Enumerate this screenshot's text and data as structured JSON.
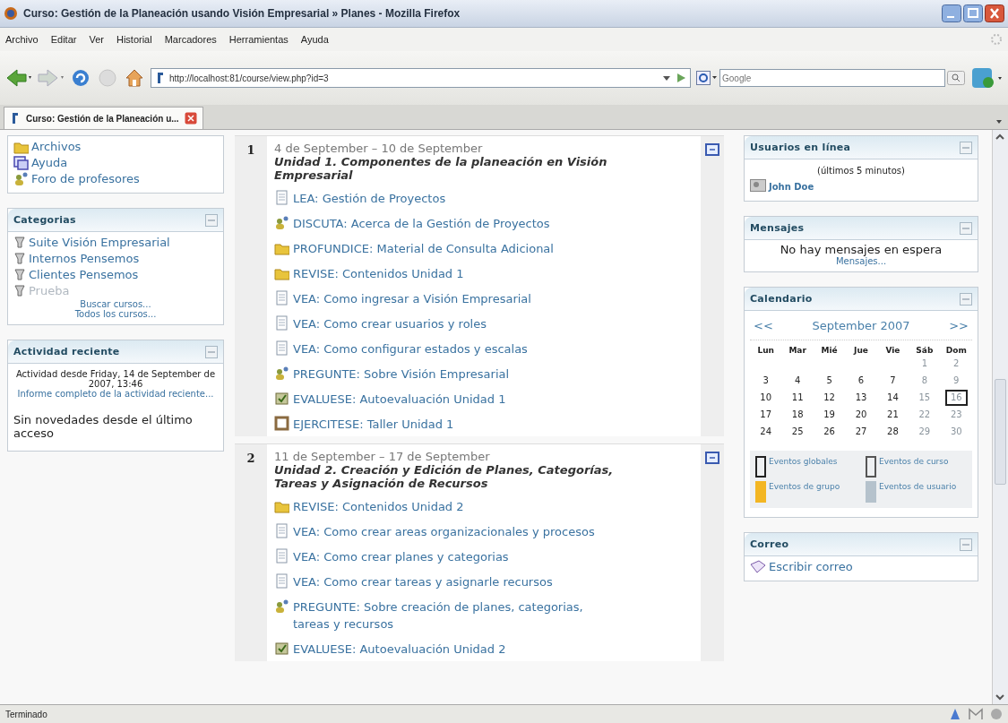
{
  "window": {
    "title": "Curso: Gestión de la Planeación usando Visión Empresarial » Planes - Mozilla Firefox"
  },
  "menu": [
    "Archivo",
    "Editar",
    "Ver",
    "Historial",
    "Marcadores",
    "Herramientas",
    "Ayuda"
  ],
  "toolbar": {
    "url": "http://localhost:81/course/view.php?id=3",
    "search": {
      "placeholder": "Google"
    }
  },
  "tabs": [
    {
      "label": "Curso: Gestión de la Planeación u...",
      "selected": true
    }
  ],
  "left_blocks": [
    {
      "kind": "links",
      "items": [
        {
          "kind": "folder",
          "label": "Archivos"
        },
        {
          "kind": "window",
          "label": "Ayuda"
        },
        {
          "kind": "forum",
          "label": "Foro de profesores"
        }
      ]
    },
    {
      "kind": "categories",
      "title": "Categorias",
      "items": [
        {
          "label": "Suite Visión Empresarial",
          "dimmed": false
        },
        {
          "label": "Internos Pensemos",
          "dimmed": false
        },
        {
          "label": "Clientes Pensemos",
          "dimmed": false
        },
        {
          "label": "Prueba",
          "dimmed": true
        }
      ],
      "links": [
        "Buscar cursos...",
        "Todos los cursos..."
      ]
    },
    {
      "kind": "activity",
      "title": "Actividad reciente",
      "since": "Actividad desde Friday, 14 de September de 2007, 13:46",
      "link": "Informe completo de la actividad reciente...",
      "note": "Sin novedades desde el último acceso"
    }
  ],
  "sections": [
    {
      "number": "1",
      "dates": "4 de September – 10 de September",
      "title": "Unidad 1. Componentes de la planeación en Visión Empresarial",
      "items": [
        {
          "kind": "page",
          "label": "LEA: Gestión de Proyectos"
        },
        {
          "kind": "forum",
          "label": "DISCUTA: Acerca de la Gestión de Proyectos"
        },
        {
          "kind": "folder",
          "label": "PROFUNDICE: Material de Consulta Adicional"
        },
        {
          "kind": "folder",
          "label": "REVISE: Contenidos Unidad 1"
        },
        {
          "kind": "page",
          "label": "VEA: Como ingresar a Visión Empresarial"
        },
        {
          "kind": "page",
          "label": "VEA: Como crear usuarios y roles"
        },
        {
          "kind": "page",
          "label": "VEA: Como configurar estados y escalas"
        },
        {
          "kind": "forum",
          "label": "PREGUNTE: Sobre Visión Empresarial"
        },
        {
          "kind": "quiz",
          "label": "EVALUESE: Autoevaluación Unidad 1"
        },
        {
          "kind": "assignment",
          "label": "EJERCITESE: Taller Unidad 1"
        }
      ]
    },
    {
      "number": "2",
      "dates": "11 de September – 17 de September",
      "title": "Unidad 2. Creación y Edición de Planes, Categorías, Tareas y Asignación de Recursos",
      "items": [
        {
          "kind": "folder",
          "label": "REVISE: Contenidos Unidad 2"
        },
        {
          "kind": "page",
          "label": "VEA: Como crear areas organizacionales y procesos"
        },
        {
          "kind": "page",
          "label": "VEA: Como crear planes y categorias"
        },
        {
          "kind": "page",
          "label": "VEA: Como crear tareas y asignarle recursos"
        },
        {
          "kind": "forum",
          "label": "PREGUNTE: Sobre creación de planes, categorias, tareas y recursos"
        },
        {
          "kind": "quiz",
          "label": "EVALUESE: Autoevaluación Unidad 2"
        }
      ]
    }
  ],
  "right_blocks": [
    {
      "kind": "online",
      "title": "Usuarios en línea",
      "subtitle": "(últimos 5 minutos)",
      "users": [
        "John Doe"
      ]
    },
    {
      "kind": "messages",
      "title": "Mensajes",
      "text": "No hay mensajes en espera",
      "link": "Mensajes..."
    },
    {
      "kind": "calendar",
      "title": "Calendario",
      "prev": "<<",
      "month": "September 2007",
      "next": ">>",
      "weekdays": [
        "Lun",
        "Mar",
        "Mié",
        "Jue",
        "Vie",
        "Sáb",
        "Dom"
      ],
      "weeks": [
        [
          {
            "day": "1",
            "weekend": true,
            "today": false
          },
          {
            "day": "2",
            "weekend": true,
            "today": false
          }
        ],
        [
          {
            "day": "3",
            "weekend": false,
            "today": false
          },
          {
            "day": "4",
            "weekend": false,
            "today": false
          },
          {
            "day": "5",
            "weekend": false,
            "today": false
          },
          {
            "day": "6",
            "weekend": false,
            "today": false
          },
          {
            "day": "7",
            "weekend": false,
            "today": false
          },
          {
            "day": "8",
            "weekend": true,
            "today": false
          },
          {
            "day": "9",
            "weekend": true,
            "today": false
          }
        ],
        [
          {
            "day": "10",
            "weekend": false,
            "today": false
          },
          {
            "day": "11",
            "weekend": false,
            "today": false
          },
          {
            "day": "12",
            "weekend": false,
            "today": false
          },
          {
            "day": "13",
            "weekend": false,
            "today": false
          },
          {
            "day": "14",
            "weekend": false,
            "today": false
          },
          {
            "day": "15",
            "weekend": true,
            "today": false
          },
          {
            "day": "16",
            "weekend": true,
            "today": true
          }
        ],
        [
          {
            "day": "17",
            "weekend": false,
            "today": false
          },
          {
            "day": "18",
            "weekend": false,
            "today": false
          },
          {
            "day": "19",
            "weekend": false,
            "today": false
          },
          {
            "day": "20",
            "weekend": false,
            "today": false
          },
          {
            "day": "21",
            "weekend": false,
            "today": false
          },
          {
            "day": "22",
            "weekend": true,
            "today": false
          },
          {
            "day": "23",
            "weekend": true,
            "today": false
          }
        ],
        [
          {
            "day": "24",
            "weekend": false,
            "today": false
          },
          {
            "day": "25",
            "weekend": false,
            "today": false
          },
          {
            "day": "26",
            "weekend": false,
            "today": false
          },
          {
            "day": "27",
            "weekend": false,
            "today": false
          },
          {
            "day": "28",
            "weekend": false,
            "today": false
          },
          {
            "day": "29",
            "weekend": true,
            "today": false
          },
          {
            "day": "30",
            "weekend": true,
            "today": false
          }
        ]
      ],
      "legend": [
        {
          "kind": "outline",
          "color": "#222222",
          "label": "Eventos globales"
        },
        {
          "kind": "outline",
          "color": "#555555",
          "label": "Eventos de curso"
        },
        {
          "kind": "fill",
          "color": "#f3b623",
          "label": "Eventos de grupo"
        },
        {
          "kind": "fill",
          "color": "#b5c2cc",
          "label": "Eventos de usuario"
        }
      ]
    },
    {
      "kind": "mail",
      "title": "Correo",
      "link": "Escribir correo"
    }
  ],
  "status_bar": {
    "text": "Terminado"
  }
}
